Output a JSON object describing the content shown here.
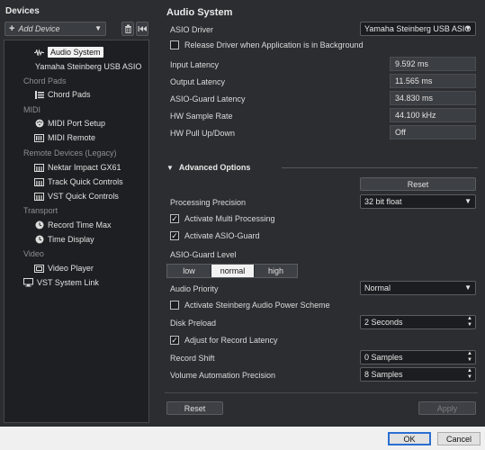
{
  "left": {
    "title": "Devices",
    "add_device": "Add Device",
    "tree": [
      {
        "kind": "item",
        "name": "audio-system",
        "label": "Audio System",
        "icon": "audio-waveform-icon",
        "selected": true
      },
      {
        "kind": "sub",
        "name": "yamaha-driver",
        "label": "Yamaha Steinberg USB ASIO"
      },
      {
        "kind": "cat",
        "name": "chord-pads-category",
        "label": "Chord Pads"
      },
      {
        "kind": "item",
        "name": "chord-pads",
        "label": "Chord Pads",
        "icon": "chord-pads-icon"
      },
      {
        "kind": "cat",
        "name": "midi-category",
        "label": "MIDI"
      },
      {
        "kind": "item",
        "name": "midi-port-setup",
        "label": "MIDI Port Setup",
        "icon": "midi-port-icon"
      },
      {
        "kind": "item",
        "name": "midi-remote",
        "label": "MIDI Remote",
        "icon": "midi-remote-icon"
      },
      {
        "kind": "cat",
        "name": "remote-devices-category",
        "label": "Remote Devices (Legacy)"
      },
      {
        "kind": "item",
        "name": "nektar-impact",
        "label": "Nektar Impact GX61",
        "icon": "controller-icon"
      },
      {
        "kind": "item",
        "name": "track-quick-controls",
        "label": "Track Quick Controls",
        "icon": "controller-icon"
      },
      {
        "kind": "item",
        "name": "vst-quick-controls",
        "label": "VST Quick Controls",
        "icon": "controller-icon"
      },
      {
        "kind": "cat",
        "name": "transport-category",
        "label": "Transport"
      },
      {
        "kind": "item",
        "name": "record-time-max",
        "label": "Record Time Max",
        "icon": "clock-icon"
      },
      {
        "kind": "item",
        "name": "time-display",
        "label": "Time Display",
        "icon": "clock-icon"
      },
      {
        "kind": "cat",
        "name": "video-category",
        "label": "Video"
      },
      {
        "kind": "item",
        "name": "video-player",
        "label": "Video Player",
        "icon": "video-player-icon"
      },
      {
        "kind": "item2",
        "name": "vst-system-link",
        "label": "VST System Link",
        "icon": "monitor-icon"
      }
    ]
  },
  "right": {
    "title": "Audio System",
    "asio_driver_label": "ASIO Driver",
    "asio_driver_value": "Yamaha Steinberg USB ASIO",
    "release_driver_label": "Release Driver when Application is in Background",
    "release_driver_checked": false,
    "input_latency_label": "Input Latency",
    "input_latency_value": "9.592 ms",
    "output_latency_label": "Output Latency",
    "output_latency_value": "11.565 ms",
    "asio_guard_latency_label": "ASIO-Guard Latency",
    "asio_guard_latency_value": "34.830 ms",
    "hw_sample_rate_label": "HW Sample Rate",
    "hw_sample_rate_value": "44.100 kHz",
    "hw_pull_label": "HW Pull Up/Down",
    "hw_pull_value": "Off",
    "advanced_label": "Advanced Options",
    "reset_label": "Reset",
    "processing_precision_label": "Processing Precision",
    "processing_precision_value": "32 bit float",
    "multi_processing_label": "Activate Multi Processing",
    "multi_processing_checked": true,
    "asio_guard_label": "Activate ASIO-Guard",
    "asio_guard_checked": true,
    "asio_guard_level_label": "ASIO-Guard Level",
    "levels": [
      "low",
      "normal",
      "high"
    ],
    "level_selected": "normal",
    "audio_priority_label": "Audio Priority",
    "audio_priority_value": "Normal",
    "power_scheme_label": "Activate Steinberg Audio Power Scheme",
    "power_scheme_checked": false,
    "disk_preload_label": "Disk Preload",
    "disk_preload_value": "2 Seconds",
    "record_latency_label": "Adjust for Record Latency",
    "record_latency_checked": true,
    "record_shift_label": "Record Shift",
    "record_shift_value": "0 Samples",
    "volume_precision_label": "Volume Automation Precision",
    "volume_precision_value": "8 Samples",
    "bottom_reset_label": "Reset",
    "apply_label": "Apply"
  },
  "footer": {
    "ok_label": "OK",
    "cancel_label": "Cancel"
  },
  "checkmark": "✓"
}
